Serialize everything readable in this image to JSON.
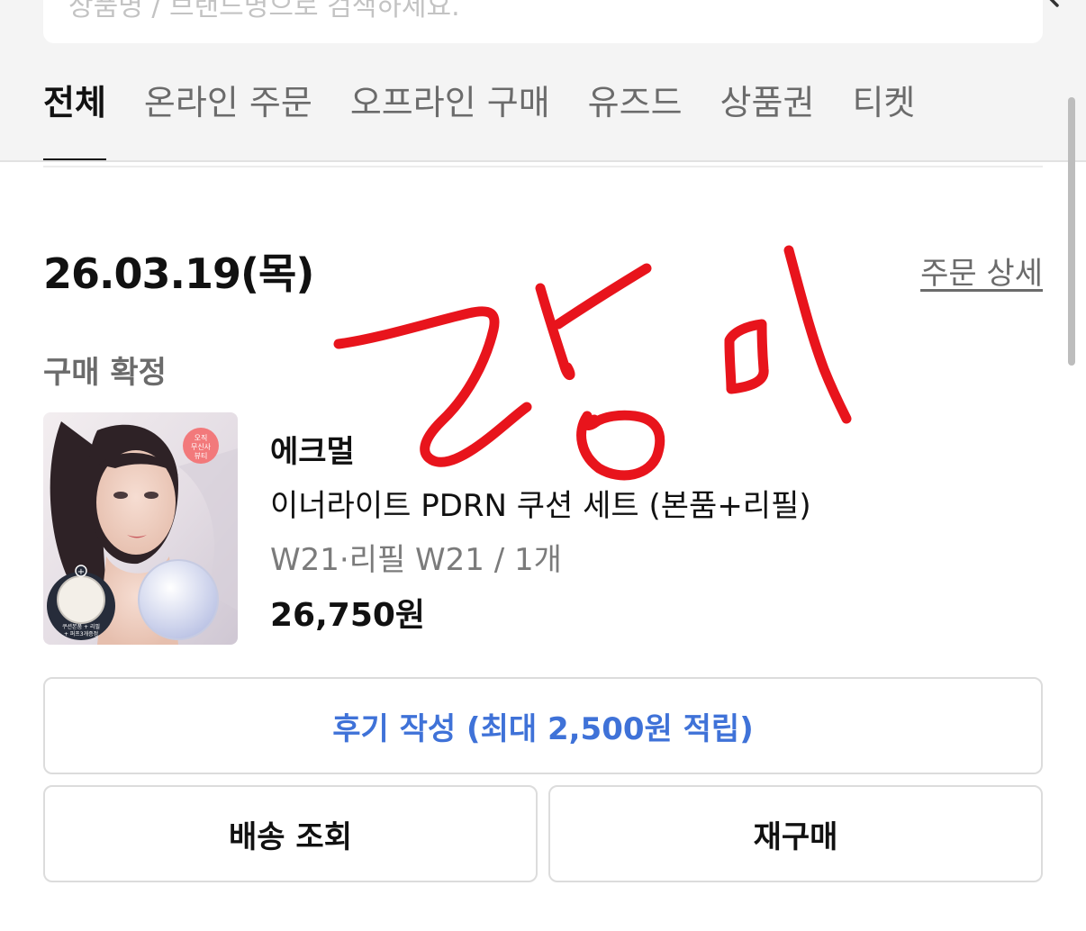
{
  "search": {
    "placeholder": "상품명 / 브랜드명으로 검색하세요."
  },
  "tabs": [
    {
      "label": "전체",
      "active": true
    },
    {
      "label": "온라인 주문",
      "active": false
    },
    {
      "label": "오프라인 구매",
      "active": false
    },
    {
      "label": "유즈드",
      "active": false
    },
    {
      "label": "상품권",
      "active": false
    },
    {
      "label": "티켓",
      "active": false
    }
  ],
  "order": {
    "date": "26.03.19(목)",
    "detail_link": "주문 상세",
    "status": "구매 확정",
    "product": {
      "thumb_badge_lines": [
        "오직",
        "무신사",
        "뷰티"
      ],
      "thumb_caption_lines": [
        "쿠션본품 + 리필",
        "+ 퍼프3개증정"
      ],
      "brand": "에크멀",
      "name": "이너라이트 PDRN 쿠션 세트 (본품+리필)",
      "option": "W21·리필 W21 / 1개",
      "price": "26,750원"
    },
    "buttons": {
      "review": "후기 작성 (최대 2,500원 적립)",
      "tracking": "배송 조회",
      "reorder": "재구매"
    }
  },
  "colors": {
    "review_text": "#3f72d8",
    "scribble": "#e8141c"
  },
  "icons": {
    "search": "search-icon"
  }
}
